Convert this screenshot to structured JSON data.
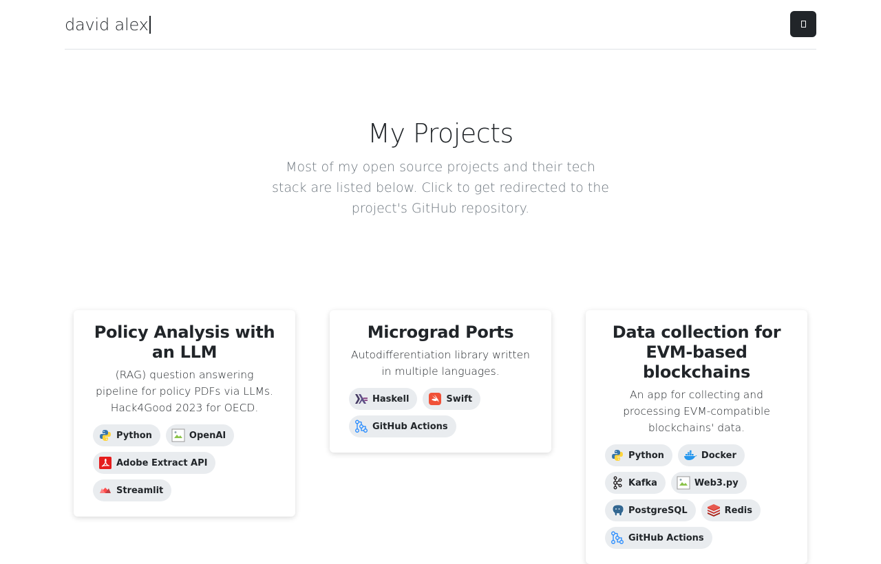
{
  "header": {
    "brand": "david alex"
  },
  "hero": {
    "title": "My Projects",
    "subtitle": "Most of my open source projects and their tech stack are listed below. Click to get redirected to the project's GitHub repository."
  },
  "projects": [
    {
      "title": "Policy Analysis with an LLM",
      "description": "(RAG) question answering pipeline for policy PDFs via LLMs. Hack4Good 2023 for OECD.",
      "badges": [
        {
          "label": "Python",
          "icon": "python-icon"
        },
        {
          "label": "OpenAI",
          "icon": "broken-image-icon"
        },
        {
          "label": "Adobe Extract API",
          "icon": "adobe-icon"
        },
        {
          "label": "Streamlit",
          "icon": "streamlit-icon"
        }
      ]
    },
    {
      "title": "Micrograd Ports",
      "description": "Autodifferentiation library written in multiple languages.",
      "badges": [
        {
          "label": "Haskell",
          "icon": "haskell-icon"
        },
        {
          "label": "Swift",
          "icon": "swift-icon"
        },
        {
          "label": "GitHub Actions",
          "icon": "github-actions-icon"
        }
      ]
    },
    {
      "title": "Data collection for EVM-based blockchains",
      "description": "An app for collecting and processing EVM-compatible blockchains' data.",
      "badges": [
        {
          "label": "Python",
          "icon": "python-icon"
        },
        {
          "label": "Docker",
          "icon": "docker-icon"
        },
        {
          "label": "Kafka",
          "icon": "kafka-icon"
        },
        {
          "label": "Web3.py",
          "icon": "broken-image-icon"
        },
        {
          "label": "PostgreSQL",
          "icon": "postgresql-icon"
        },
        {
          "label": "Redis",
          "icon": "redis-icon"
        },
        {
          "label": "GitHub Actions",
          "icon": "github-actions-icon"
        }
      ]
    }
  ],
  "colors": {
    "text": "#212529",
    "muted": "#6c757d",
    "badge_bg": "#e9ecef",
    "button_bg": "#212529"
  }
}
